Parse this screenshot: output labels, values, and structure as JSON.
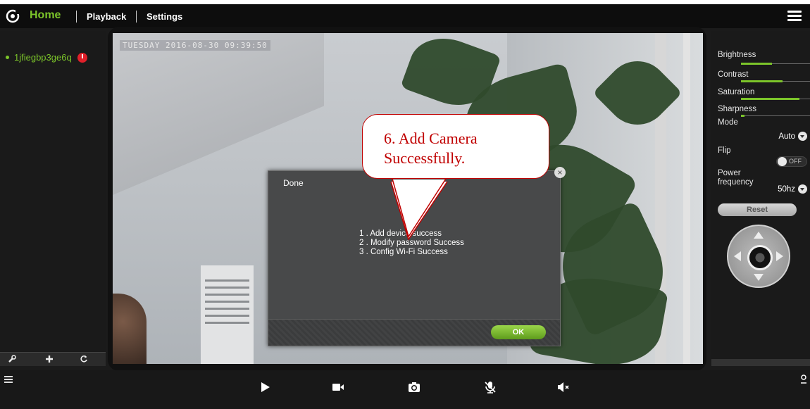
{
  "nav": {
    "home": "Home",
    "playback": "Playback",
    "settings": "Settings"
  },
  "device": {
    "name": "1jfiegbp3ge6q"
  },
  "video": {
    "timestamp": "TUESDAY 2016-08-30 09:39:50"
  },
  "dialog": {
    "title": "Done",
    "messages": [
      "1 . Add device success",
      "2 . Modify password Success",
      "3 . Config Wi-Fi Success"
    ],
    "ok_label": "OK"
  },
  "callout": {
    "line1": "6. Add Camera",
    "line2": "Successfully."
  },
  "settings_panel": {
    "brightness": {
      "label": "Brightness",
      "level": 0.45
    },
    "contrast": {
      "label": "Contrast",
      "level": 0.6
    },
    "saturation": {
      "label": "Saturation",
      "level": 0.85
    },
    "sharpness": {
      "label": "Sharpness",
      "level": 0.05
    },
    "mode": {
      "label": "Mode",
      "value": "Auto"
    },
    "flip": {
      "label": "Flip",
      "value": "OFF"
    },
    "power_frequency": {
      "label_line1": "Power",
      "label_line2": "frequency",
      "value": "50hz"
    },
    "reset_label": "Reset"
  },
  "colors": {
    "accent": "#7cc52a",
    "callout": "#c00000"
  }
}
